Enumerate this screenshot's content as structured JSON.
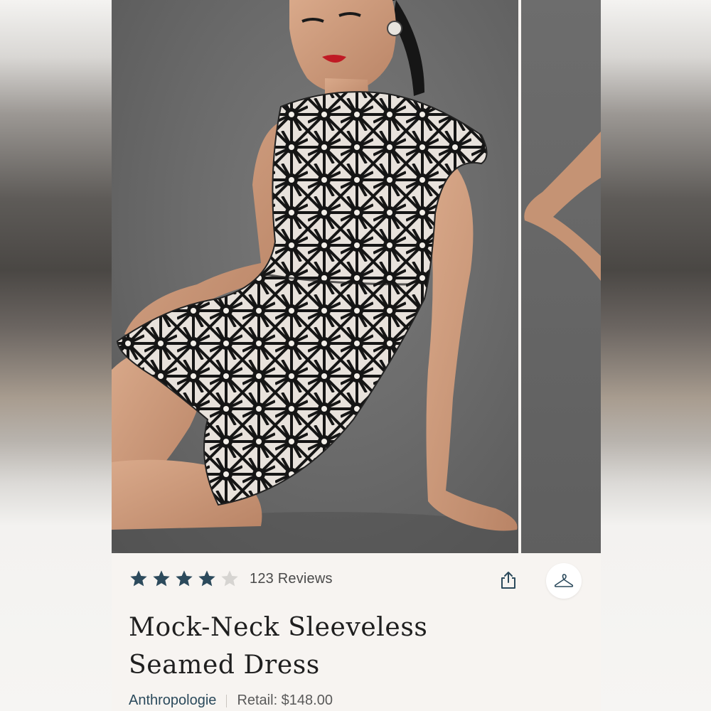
{
  "product": {
    "rating_value": 4,
    "rating_max": 5,
    "reviews_label": "123 Reviews",
    "title_line1": "Mock-Neck Sleeveless",
    "title_line2": "Seamed Dress",
    "brand": "Anthropologie",
    "retail_label": "Retail: $148.00"
  },
  "icons": {
    "share": "share-icon",
    "hanger": "hanger-icon",
    "star": "star-icon"
  },
  "colors": {
    "star_filled": "#2c4a5c",
    "star_empty": "#d6d4d1",
    "brand_link": "#2b4a5c",
    "card_bg": "#f7f4f1"
  }
}
